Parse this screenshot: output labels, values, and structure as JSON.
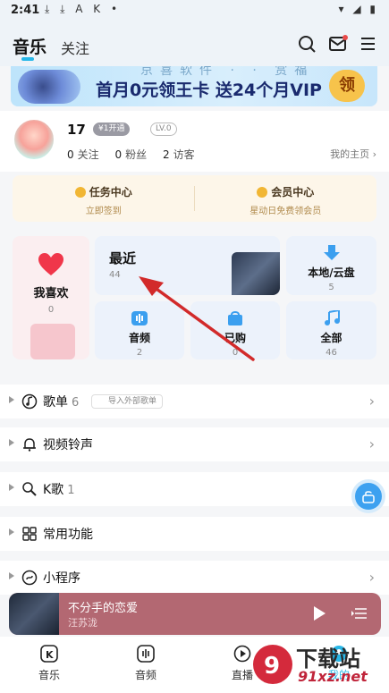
{
  "status_bar": {
    "time": "2:41",
    "indicators": "⤓ ⤓ A K •",
    "right_icons": "▾ ◢ ▮"
  },
  "header": {
    "tabs": [
      "音乐",
      "关注"
    ],
    "active_tab": "音乐",
    "icons": [
      "search-icon",
      "mail-icon",
      "menu-icon"
    ]
  },
  "banner": {
    "top_text": "京喜软件 · · 赏福",
    "main_text": "首月0元领王卡 送24个月VIP",
    "button_label": "领"
  },
  "profile": {
    "name": "17",
    "vip_badge": "¥1开通",
    "level": "LV.0",
    "follow": "0",
    "follow_label": "关注",
    "fans": "0",
    "fans_label": "粉丝",
    "visitors": "2",
    "visitors_label": "访客",
    "home_link": "我的主页"
  },
  "vip_card": {
    "task_title": "任务中心",
    "task_sub": "立即签到",
    "member_title": "会员中心",
    "member_sub": "星动日免费领会员"
  },
  "tiles": {
    "favorite": {
      "label": "我喜欢",
      "count": "0"
    },
    "recent": {
      "label": "最近",
      "count": "44"
    },
    "local": {
      "label": "本地/云盘",
      "count": "5"
    },
    "audio": {
      "label": "音频",
      "count": "2"
    },
    "bought": {
      "label": "已购",
      "count": "0"
    },
    "all": {
      "label": "全部",
      "count": "46"
    }
  },
  "list": {
    "playlist": {
      "label": "歌单",
      "count": "6",
      "import": "导入外部歌单"
    },
    "ringtone": {
      "label": "视频铃声"
    },
    "karaoke": {
      "label": "K歌",
      "count": "1"
    },
    "common": {
      "label": "常用功能"
    },
    "mini": {
      "label": "小程序"
    }
  },
  "player": {
    "title": "不分手的恋爱",
    "artist": "汪苏泷"
  },
  "tabbar": {
    "music": "音乐",
    "audio": "音频",
    "live": "直播",
    "mine": "我的"
  },
  "watermark": {
    "text": "下载站",
    "sub": "91xz.net"
  },
  "colors": {
    "accent": "#28b7e8",
    "player_bg": "#b36872",
    "arrow": "#d22a2a",
    "vip_bg": "#fdf6e9"
  }
}
